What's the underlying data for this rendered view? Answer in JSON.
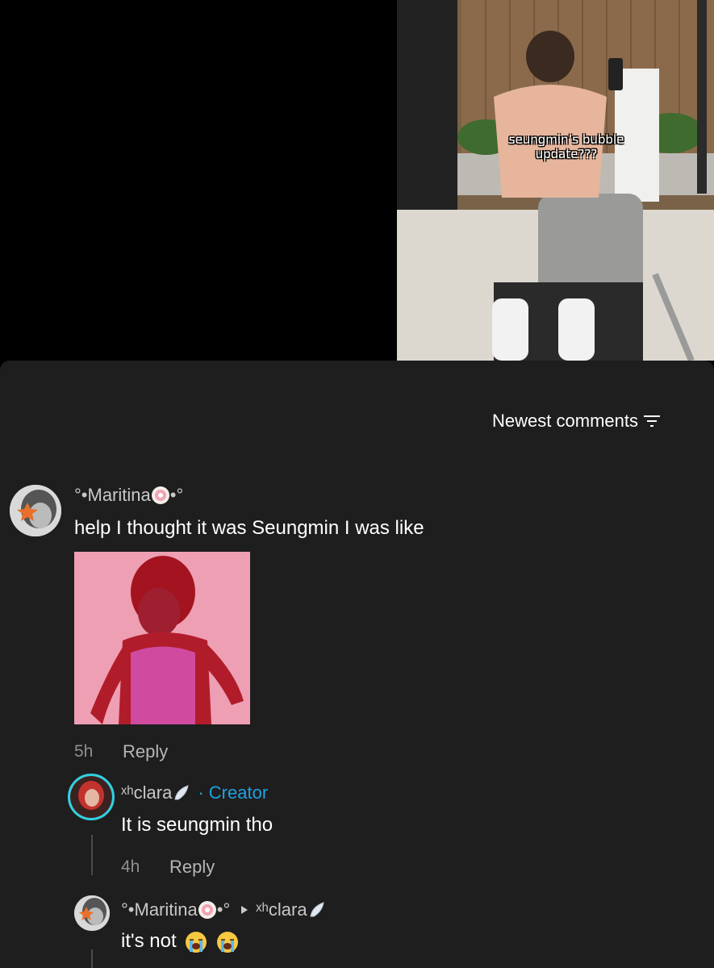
{
  "video": {
    "caption": "seungmin’s bubble\nupdate???"
  },
  "sort": {
    "label": "Newest comments"
  },
  "comments": [
    {
      "user_prefix": "°•Maritina",
      "user_suffix": "•°",
      "text": "help I thought it was Seungmin I was like",
      "time": "5h",
      "reply_label": "Reply"
    },
    {
      "user_prefix": "ˣʰclara",
      "creator_label": "· Creator",
      "text": "It is seungmin tho",
      "time": "4h",
      "reply_label": "Reply"
    },
    {
      "user_prefix": "°•Maritina",
      "user_suffix": "•°",
      "reply_to": "ˣʰclara",
      "text": "it's not"
    }
  ],
  "colors": {
    "creator": "#1fa0e0",
    "sheet": "#1e1e1f"
  }
}
